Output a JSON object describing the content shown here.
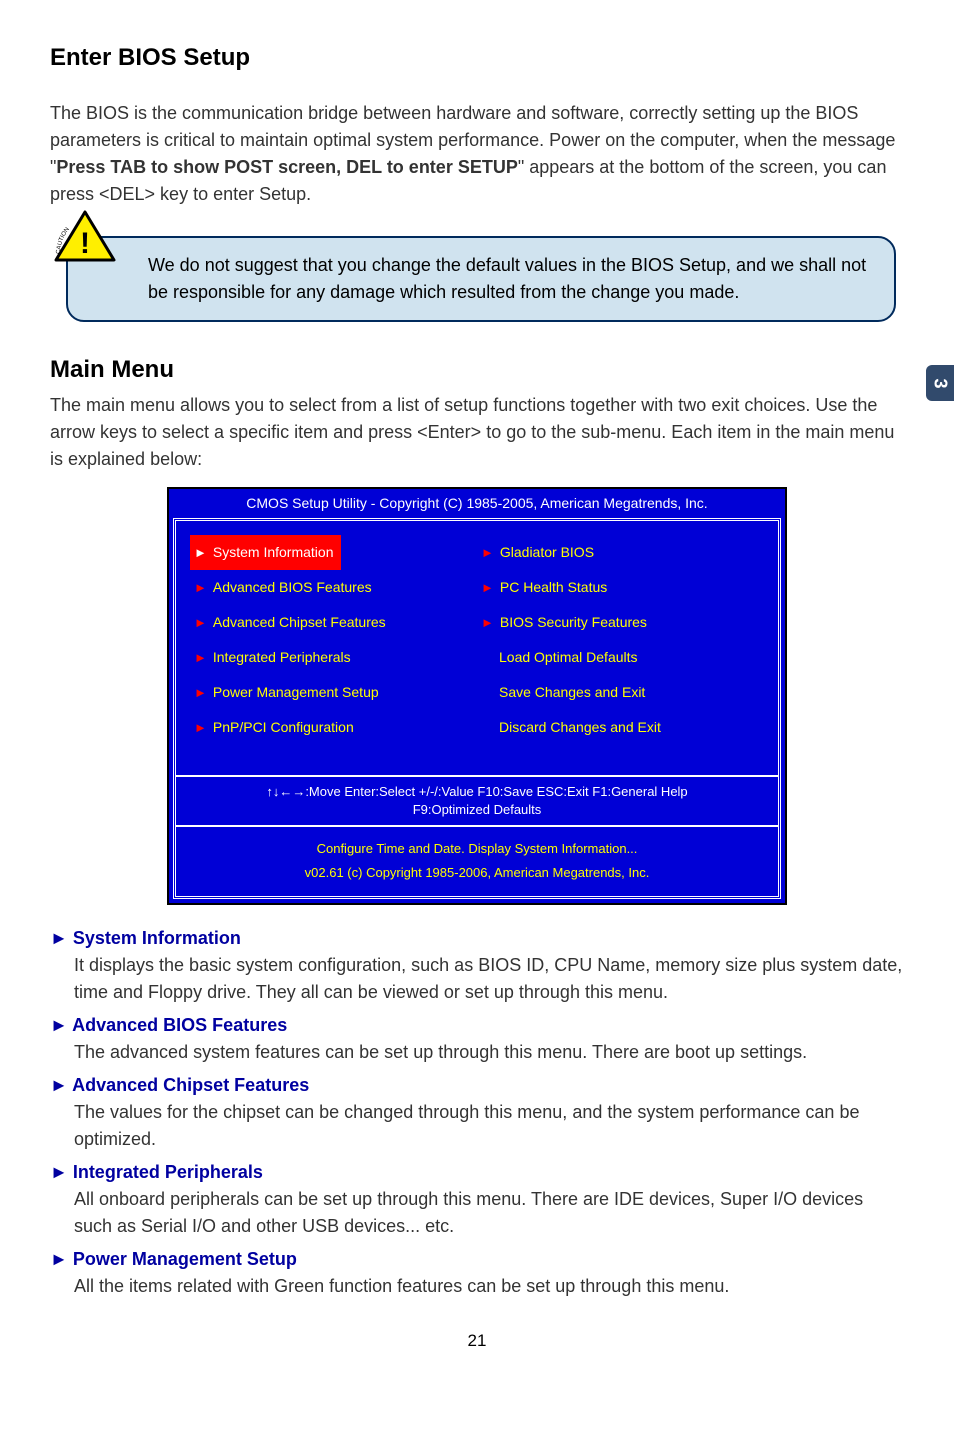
{
  "page_tab": "3",
  "page_number": "21",
  "section1": {
    "title": "Enter BIOS Setup",
    "para_pre": "The BIOS is the communication bridge between hardware and software, correctly setting up the BIOS parameters is critical to maintain optimal system performance. Power on the computer, when the message \"",
    "para_bold": "Press TAB to show POST screen, DEL to enter SETUP",
    "para_post": "\" appears at the bottom of the screen, you can press <DEL> key to enter Setup."
  },
  "caution": {
    "label": "CAUTION",
    "text": "We do not suggest that you change the default values in the BIOS Setup, and we shall not be responsible for any damage which resulted from the change you made."
  },
  "section2": {
    "title": "Main Menu",
    "para": "The main menu allows you to select from a list of setup functions together with two exit choices. Use the arrow keys to select a specific item and press <Enter> to go to the sub-menu. Each item in the main menu is explained below:"
  },
  "bios": {
    "titlebar": "CMOS Setup Utility - Copyright (C) 1985-2005, American Megatrends, Inc.",
    "left": [
      {
        "label": "System Information",
        "arrow": true,
        "selected": true
      },
      {
        "label": "Advanced BIOS Features",
        "arrow": true
      },
      {
        "label": "Advanced Chipset Features",
        "arrow": true
      },
      {
        "label": "Integrated Peripherals",
        "arrow": true
      },
      {
        "label": "Power Management Setup",
        "arrow": true
      },
      {
        "label": "PnP/PCI Configuration",
        "arrow": true
      }
    ],
    "right": [
      {
        "label": "Gladiator BIOS",
        "arrow": true
      },
      {
        "label": "PC Health Status",
        "arrow": true
      },
      {
        "label": "BIOS Security Features",
        "arrow": true
      },
      {
        "label": "Load Optimal Defaults",
        "arrow": false
      },
      {
        "label": "Save Changes and Exit",
        "arrow": false
      },
      {
        "label": "Discard Changes and Exit",
        "arrow": false
      }
    ],
    "help_line1": "↑↓←→:Move  Enter:Select    +/-/:Value     F10:Save   ESC:Exit       F1:General Help",
    "help_line2": "F9:Optimized Defaults",
    "footer_line1": "Configure Time and Date.  Display System Information...",
    "footer_line2": "v02.61   (c) Copyright 1985-2006, American Megatrends, Inc."
  },
  "explain": [
    {
      "title": "► System Information",
      "body": "It displays the basic system configuration, such as BIOS ID, CPU Name, memory size plus system date, time and Floppy drive. They all can be viewed or set up through this menu."
    },
    {
      "title": "► Advanced BIOS Features",
      "body": "The advanced system features can be set up through this menu. There are boot up settings."
    },
    {
      "title": "► Advanced Chipset Features",
      "body": "The values for the chipset can be changed through this menu, and the system performance can be optimized."
    },
    {
      "title": "► Integrated Peripherals",
      "body": "All onboard peripherals can be set up through this menu. There are IDE devices, Super I/O devices such as Serial I/O and other USB devices... etc."
    },
    {
      "title": "► Power Management Setup",
      "body": "All the items related with Green function features can be set up through this menu."
    }
  ]
}
